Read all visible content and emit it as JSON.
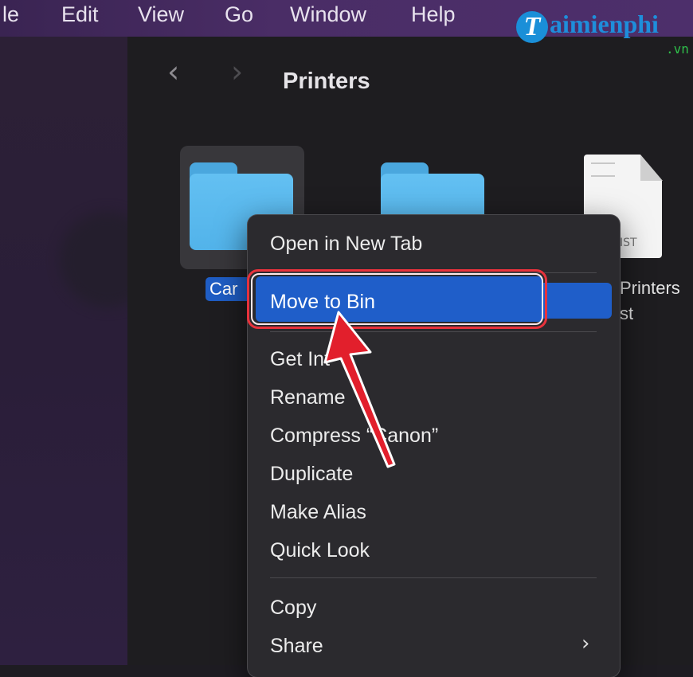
{
  "menubar": {
    "items": [
      "le",
      "Edit",
      "View",
      "Go",
      "Window",
      "Help"
    ]
  },
  "toolbar": {
    "back_icon": "chevron-left-icon",
    "forward_icon": "chevron-right-icon",
    "title": "Printers"
  },
  "files": [
    {
      "name": "Car",
      "icon": "folder-icon",
      "selected": true
    },
    {
      "name": "",
      "icon": "folder-icon",
      "selected": false
    },
    {
      "name_line1": "Printers",
      "name_line2": "st",
      "icon": "document-icon",
      "doc_label": "IST"
    }
  ],
  "context_menu": {
    "items": [
      {
        "label": "Open in New Tab"
      },
      {
        "label": "Move to Bin",
        "highlighted": true
      },
      {
        "label": "Get Int"
      },
      {
        "label": "Rename"
      },
      {
        "label": "Compress “Canon”"
      },
      {
        "label": "Duplicate"
      },
      {
        "label": "Make Alias"
      },
      {
        "label": "Quick Look"
      },
      {
        "label": "Copy"
      },
      {
        "label": "Share",
        "submenu_icon": "chevron-right-icon"
      }
    ]
  },
  "annotation": {
    "highlight_color": "#e8323c",
    "arrow_icon": "red-arrow-pointer-icon"
  },
  "watermark": {
    "initial": "T",
    "text": "aimienphi",
    "suffix": ".vn"
  },
  "colors": {
    "selection": "#1f5ec9",
    "folder": "#5bb8ee",
    "menubar": "#4a2d66"
  }
}
